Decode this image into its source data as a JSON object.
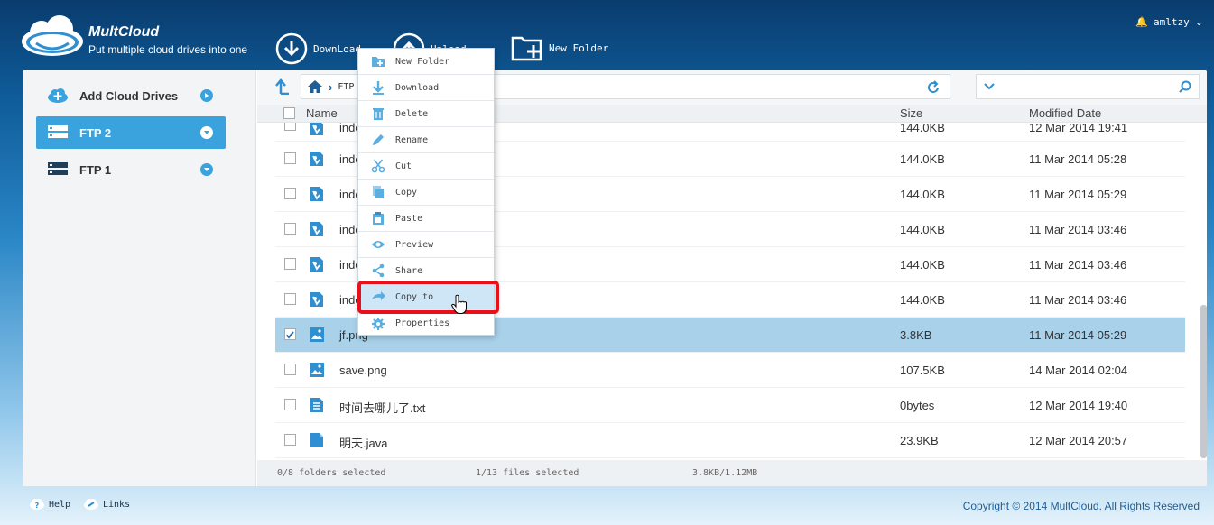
{
  "brand": {
    "name": "MultCloud",
    "tagline": "Put multiple cloud drives into one"
  },
  "toolbar": {
    "download": "DownLoad",
    "upload": "Upload",
    "new_folder": "New Folder"
  },
  "user": {
    "name": "amltzy"
  },
  "sidebar": {
    "items": [
      {
        "label": "Add Cloud Drives"
      },
      {
        "label": "FTP 2"
      },
      {
        "label": "FTP 1"
      }
    ]
  },
  "path": {
    "crumb": "FTP"
  },
  "columns": {
    "name": "Name",
    "size": "Size",
    "modified": "Modified Date"
  },
  "files": [
    {
      "name": "index",
      "size": "144.0KB",
      "date": "12 Mar 2014 19:41",
      "type": "archive"
    },
    {
      "name": "index",
      "size": "144.0KB",
      "date": "11 Mar 2014 05:28",
      "type": "archive"
    },
    {
      "name": "index",
      "size": "144.0KB",
      "date": "11 Mar 2014 05:29",
      "type": "archive"
    },
    {
      "name": "index",
      "size": "144.0KB",
      "date": "11 Mar 2014 03:46",
      "type": "archive"
    },
    {
      "name": "index",
      "size": "144.0KB",
      "date": "11 Mar 2014 03:46",
      "type": "archive"
    },
    {
      "name": "index",
      "size": "144.0KB",
      "date": "11 Mar 2014 03:46",
      "type": "archive"
    },
    {
      "name": "jf.png",
      "size": "3.8KB",
      "date": "11 Mar 2014 05:29",
      "type": "image"
    },
    {
      "name": "save.png",
      "size": "107.5KB",
      "date": "14 Mar 2014 02:04",
      "type": "image"
    },
    {
      "name": "时间去哪儿了.txt",
      "size": "0bytes",
      "date": "12 Mar 2014 19:40",
      "type": "text"
    },
    {
      "name": "明天.java",
      "size": "23.9KB",
      "date": "12 Mar 2014 20:57",
      "type": "file"
    }
  ],
  "status": {
    "folders": "0/8 folders selected",
    "files": "1/13 files selected",
    "size": "3.8KB/1.12MB"
  },
  "context_menu": {
    "items": [
      {
        "label": "New Folder",
        "icon": "new-folder-icon"
      },
      {
        "label": "Download",
        "icon": "download-icon"
      },
      {
        "label": "Delete",
        "icon": "trash-icon"
      },
      {
        "label": "Rename",
        "icon": "pencil-icon"
      },
      {
        "label": "Cut",
        "icon": "scissors-icon"
      },
      {
        "label": "Copy",
        "icon": "copy-icon"
      },
      {
        "label": "Paste",
        "icon": "paste-icon"
      },
      {
        "label": "Preview",
        "icon": "eye-icon"
      },
      {
        "label": "Share",
        "icon": "share-icon"
      },
      {
        "label": "Copy to",
        "icon": "copy-to-icon"
      },
      {
        "label": "Properties",
        "icon": "gear-icon"
      }
    ]
  },
  "bottom": {
    "help": "Help",
    "links": "Links",
    "copyright": "Copyright © 2014 MultCloud. All Rights Reserved"
  },
  "colors": {
    "accent": "#3aa3dd",
    "selected_row": "#a9d1ea",
    "highlight": "#e8101a"
  }
}
